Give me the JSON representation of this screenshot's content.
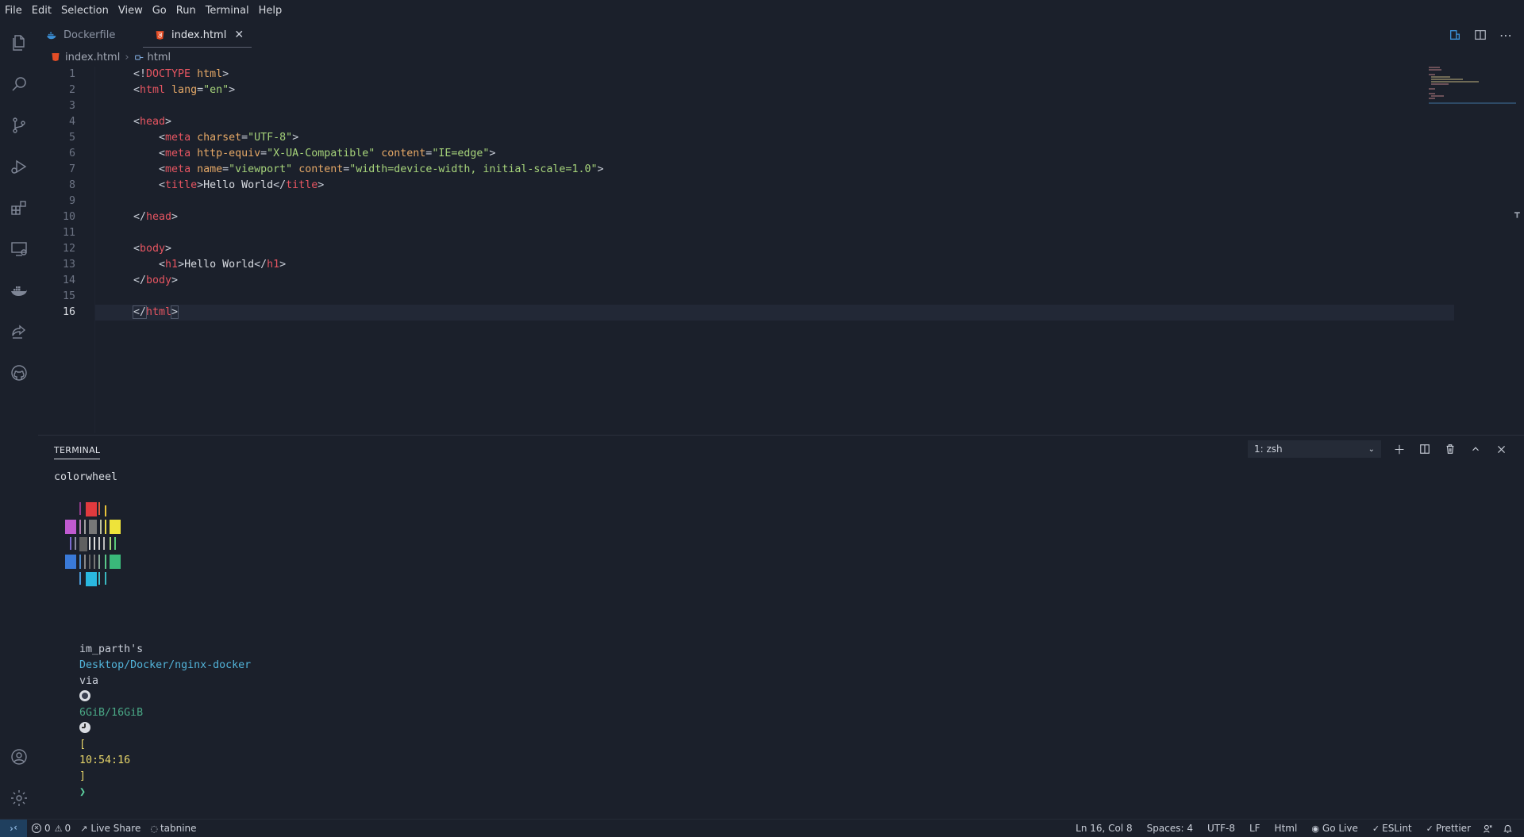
{
  "menu": [
    "File",
    "Edit",
    "Selection",
    "View",
    "Go",
    "Run",
    "Terminal",
    "Help"
  ],
  "activity": [
    "explorer-icon",
    "search-icon",
    "source-control-icon",
    "run-debug-icon",
    "extensions-icon",
    "remote-explorer-icon",
    "docker-icon",
    "live-share-icon",
    "github-icon",
    "account-icon",
    "settings-gear-icon"
  ],
  "tabs": [
    {
      "label": "Dockerfile",
      "icon": "docker-icon",
      "active": false
    },
    {
      "label": "index.html",
      "icon": "html5-icon",
      "active": true
    }
  ],
  "breadcrumb": {
    "file": "index.html",
    "symbol": "html"
  },
  "editor": {
    "line_numbers": [
      "1",
      "2",
      "3",
      "4",
      "5",
      "6",
      "7",
      "8",
      "9",
      "10",
      "11",
      "12",
      "13",
      "14",
      "15",
      "16"
    ],
    "current_line": 16
  },
  "code": {
    "l1": {
      "p1": "<!",
      "kw": "DOCTYPE",
      "rest": " html",
      "p2": ">"
    },
    "l2": {
      "p1": "<",
      "tag": "html",
      "attr": " lang",
      "eq": "=",
      "val": "\"en\"",
      "p2": ">"
    },
    "l4": {
      "p1": "<",
      "tag": "head",
      "p2": ">"
    },
    "l5": {
      "indent": "    ",
      "p1": "<",
      "tag": "meta",
      "attr": " charset",
      "eq": "=",
      "val": "\"UTF-8\"",
      "p2": ">"
    },
    "l6": {
      "indent": "    ",
      "p1": "<",
      "tag": "meta",
      "attr1": " http-equiv",
      "eq1": "=",
      "val1": "\"X-UA-Compatible\"",
      "attr2": " content",
      "eq2": "=",
      "val2": "\"IE=edge\"",
      "p2": ">"
    },
    "l7": {
      "indent": "    ",
      "p1": "<",
      "tag": "meta",
      "attr1": " name",
      "eq1": "=",
      "val1": "\"viewport\"",
      "attr2": " content",
      "eq2": "=",
      "val2": "\"width=device-width, initial-scale=1.0\"",
      "p2": ">"
    },
    "l8": {
      "indent": "    ",
      "p1": "<",
      "tag": "title",
      "p2": ">",
      "text": "Hello World",
      "p3": "</",
      "tag2": "title",
      "p4": ">"
    },
    "l10": {
      "p1": "</",
      "tag": "head",
      "p2": ">"
    },
    "l12": {
      "p1": "<",
      "tag": "body",
      "p2": ">"
    },
    "l13": {
      "indent": "    ",
      "p1": "<",
      "tag": "h1",
      "p2": ">",
      "text": "Hello World",
      "p3": "</",
      "tag2": "h1",
      "p4": ">"
    },
    "l14": {
      "p1": "</",
      "tag": "body",
      "p2": ">"
    },
    "l16": {
      "p1": "</",
      "tag": "html",
      "p2": ">"
    }
  },
  "panel": {
    "tab": "TERMINAL",
    "terminal_select": "1: zsh",
    "actions": [
      "new-terminal-icon",
      "split-terminal-icon",
      "kill-terminal-icon",
      "maximize-panel-icon",
      "close-panel-icon"
    ]
  },
  "terminal": {
    "command_output": "colorwheel",
    "prompt_user": "im_parth's",
    "prompt_path": "Desktop/Docker/nginx-docker",
    "prompt_via": "via",
    "prompt_memory": "6GiB/16GiB",
    "prompt_time_open": "[",
    "prompt_time": "10:54:16",
    "prompt_time_close": "]",
    "prompt_arrow": "❯"
  },
  "statusbar": {
    "errors": "0",
    "warnings": "0",
    "live_share": "Live Share",
    "tabnine": "tabnine",
    "position": "Ln 16, Col 8",
    "spaces": "Spaces: 4",
    "encoding": "UTF-8",
    "eol": "LF",
    "language": "Html",
    "go_live": "Go Live",
    "eslint": "ESLint",
    "prettier": "Prettier"
  },
  "colors": {
    "background": "#1b202b",
    "tag": "#e55561",
    "attribute": "#e5a866",
    "string": "#a6d37a",
    "path": "#52b3d9",
    "time": "#e8d66a"
  }
}
